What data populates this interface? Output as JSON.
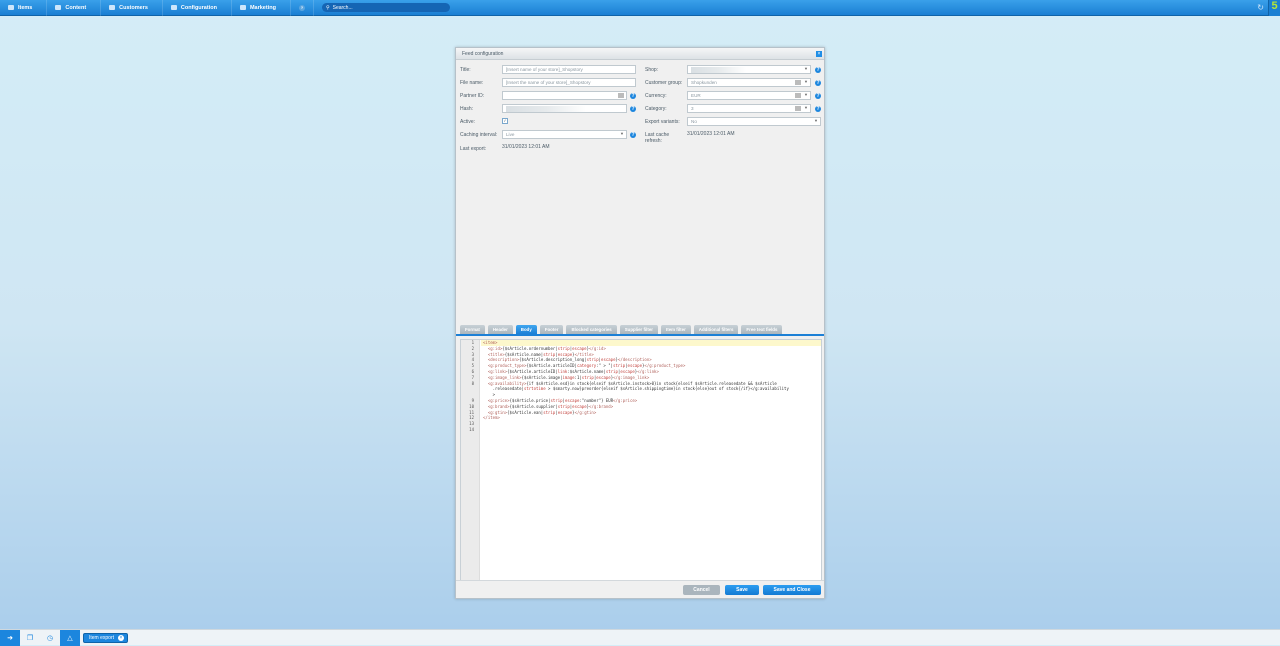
{
  "topbar": {
    "nav": [
      {
        "label": "Items",
        "icon": "items-icon"
      },
      {
        "label": "Content",
        "icon": "content-icon"
      },
      {
        "label": "Customers",
        "icon": "customers-icon"
      },
      {
        "label": "Configuration",
        "icon": "gear-icon"
      },
      {
        "label": "Marketing",
        "icon": "marketing-icon"
      }
    ],
    "help": "?",
    "search_placeholder": "Search...",
    "logo": "5"
  },
  "window": {
    "title": "Feed configuration",
    "close": "×",
    "left": {
      "title_label": "Title:",
      "title_value": "[Insert name of your store]_Shopstory",
      "filename_label": "File name:",
      "filename_value": "[Insert the name of your store]_Shopstory",
      "partner_label": "Partner ID:",
      "partner_value": "",
      "hash_label": "Hash:",
      "active_label": "Active:",
      "active_checked": true,
      "caching_label": "Caching interval:",
      "caching_value": "Live",
      "lastexport_label": "Last export:",
      "lastexport_value": "31/01/2023 12:01 AM"
    },
    "right": {
      "shop_label": "Shop:",
      "customergroup_label": "Customer group:",
      "customergroup_value": "Shopkunden",
      "currency_label": "Currency:",
      "currency_value": "EUR",
      "category_label": "Category:",
      "category_value": "3",
      "variants_label": "Export variants:",
      "variants_value": "No",
      "cache_label": "Last cache refresh:",
      "cache_value": "31/01/2023 12:01 AM"
    },
    "tabs": [
      "Format",
      "Header",
      "Body",
      "Footer",
      "Blocked categories",
      "Supplier filter",
      "Item filter",
      "Additional filters",
      "Free text fields"
    ],
    "active_tab": "Body",
    "code": [
      "<item>",
      "  <g:id>{$sArticle.ordernumber|strip|escape}</g:id>",
      "  <title>{$sArticle.name|strip|escape}</title>",
      "  <description>{$sArticle.description_long|strip|escape}</description>",
      "  <g:product_type>{$sArticle.articleID|category:\" > \"|strip|escape}</g:product_type>",
      "  <g:link>{$sArticle.articleID|link:$sArticle.name|strip|escape}</g:link>",
      "  <g:image_link>{$sArticle.image|image:1|strip|escape}</g:image_link>",
      "  <g:availability>{if $sArticle.esd}in stock{elseif $sArticle.instock>0}in stock{elseif $sArticle.releasedate && $sArticle\n    .releasedate|strtotime > $smarty.now}preorder{elseif $sArticle.shippingtime}in stock{else}out of stock{/if}</g:availability\n    >",
      "  <g:price>{$sArticle.price|strip|escape:\"number\"} EUR</g:price>",
      "  <g:brand>{$sArticle.supplier|strip|escape}</g:brand>",
      "  <g:gtin>{$sArticle.ean|strip|escape}</g:gtin>",
      "</item>",
      "",
      ""
    ],
    "buttons": {
      "cancel": "Cancel",
      "save": "Save",
      "save_close": "Save and Close"
    }
  },
  "taskbar": {
    "item_export": "Item export"
  }
}
